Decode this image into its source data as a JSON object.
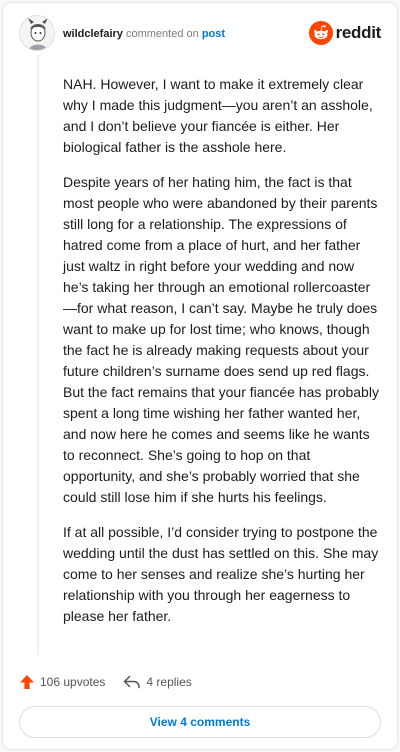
{
  "comment": {
    "username": "wildclefairy",
    "action_text": "commented on",
    "post_link": "post",
    "brand": "reddit",
    "paragraphs": [
      "NAH. However, I want to make it extremely clear why I made this judgment—you aren’t an asshole, and I don’t believe your fiancée is either. Her biological father is the asshole here.",
      "Despite years of her hating him, the fact is that most people who were abandoned by their parents still long for a relationship. The expressions of hatred come from a place of hurt, and her father just waltz in right before your wedding and now he’s taking her through an emotional rollercoaster—for what reason, I can’t say. Maybe he truly does want to make up for lost time; who knows, though the fact he is already making requests about your future children’s surname does send up red flags. But the fact remains that your fiancée has probably spent a long time wishing her father wanted her, and now here he comes and seems like he wants to reconnect. She’s going to hop on that opportunity, and she’s probably worried that she could still lose him if she hurts his feelings.",
      "If at all possible, I’d consider trying to postpone the wedding until the dust has settled on this. She may come to her senses and realize she’s hurting her relationship with you through her eagerness to please her father."
    ],
    "upvotes_label": "106 upvotes",
    "replies_label": "4 replies",
    "view_comments_label": "View 4 comments"
  },
  "colors": {
    "accent": "#0079d3",
    "reddit_orange": "#ff4500",
    "upvote": "#ff4500"
  },
  "icons": {
    "avatar": "user-avatar",
    "logo": "reddit-logo-icon",
    "upvote": "upvote-arrow-icon",
    "reply": "reply-arrow-icon"
  }
}
